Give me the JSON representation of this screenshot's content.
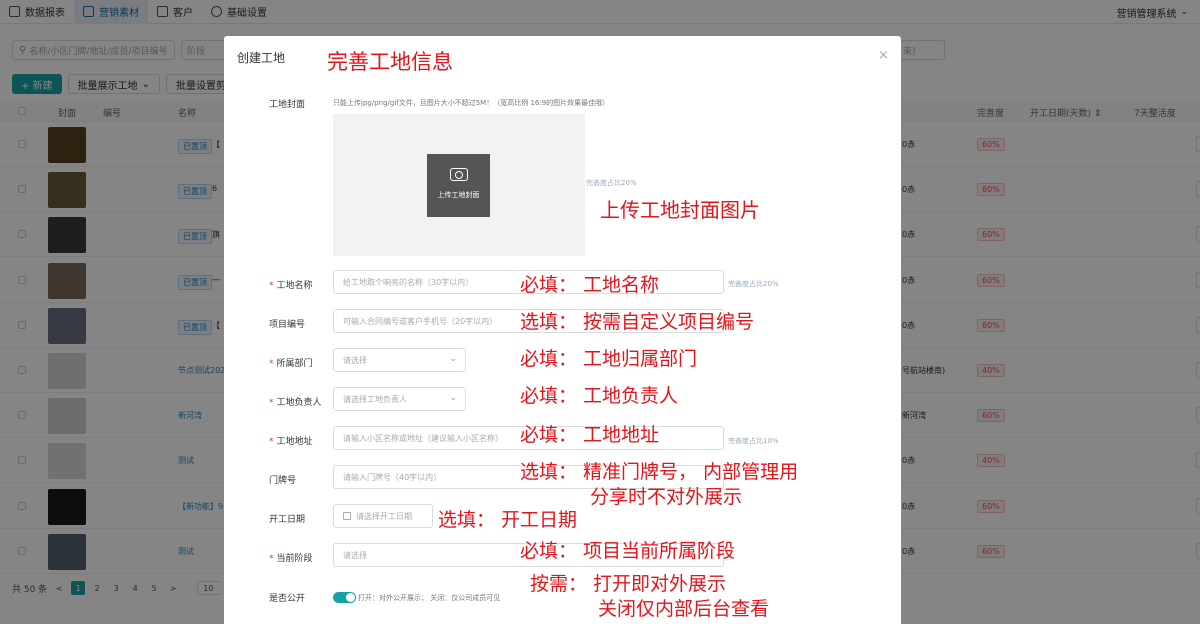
{
  "topnav": {
    "items": [
      {
        "label": "数据报表"
      },
      {
        "label": "营销素材"
      },
      {
        "label": "客户"
      },
      {
        "label": "基础设置"
      }
    ],
    "right_label": "营销管理系统"
  },
  "filters": {
    "search_placeholder": "名称/小区门牌/地址/成员/项目编号",
    "stage_placeholder": "阶段",
    "fragment": "束)"
  },
  "actions": {
    "new_label": "+ 新建",
    "batch_show_label": "批量展示工地",
    "batch_set_label": "批量设置剪辑"
  },
  "table": {
    "headers": {
      "cover": "封面",
      "code": "编号",
      "name": "名称",
      "completeness": "完善度",
      "start_days": "开工日期(天数) ⇕",
      "seven_day": "7天整活度"
    },
    "rows": [
      {
        "tag": "已置顶",
        "tag_tail": "【",
        "name": "",
        "rtext": "0赤",
        "pct": "60%",
        "color": "#5a4020"
      },
      {
        "tag": "已置顶",
        "tag_tail": "6",
        "name": "",
        "rtext": "0赤",
        "pct": "60%",
        "color": "#6a5a3a"
      },
      {
        "tag": "已置顶",
        "tag_tail": "旗",
        "name": "",
        "rtext": "0赤",
        "pct": "60%",
        "color": "#3a3a3a"
      },
      {
        "tag": "已置顶",
        "tag_tail": "一",
        "name": "",
        "rtext": "0赤",
        "pct": "60%",
        "color": "#7a6a5a"
      },
      {
        "tag": "已置顶",
        "tag_tail": "【",
        "name": "",
        "rtext": "0赤",
        "pct": "60%",
        "color": "#6a7080"
      },
      {
        "tag": "",
        "tag_tail": "",
        "name": "节点测试2024",
        "rtext": "号航站楼南)",
        "pct": "40%",
        "color": "#d5d5d5"
      },
      {
        "tag": "",
        "tag_tail": "",
        "name": "新河湾",
        "rtext": "新河湾",
        "pct": "60%",
        "color": "#cfcfcf"
      },
      {
        "tag": "",
        "tag_tail": "",
        "name": "测试",
        "rtext": "0赤",
        "pct": "40%",
        "color": "#d8d8d8"
      },
      {
        "tag": "",
        "tag_tail": "",
        "name": "【新功能】9:",
        "rtext": "0赤",
        "pct": "60%",
        "color": "#1a1a1a"
      },
      {
        "tag": "",
        "tag_tail": "",
        "name": "测试",
        "rtext": "0赤",
        "pct": "60%",
        "color": "#556070"
      }
    ]
  },
  "pager": {
    "total": "共 50 条",
    "prev": "<",
    "pages": [
      "1",
      "2",
      "3",
      "4",
      "5"
    ],
    "next": ">",
    "size": "10"
  },
  "modal": {
    "title": "创建工地",
    "close": "×",
    "cover_label": "工地封面",
    "cover_hint": "只能上传jpg/png/gif文件，且图片大小不超过5M！（宽高比例 16:9的图片效果最佳哦）",
    "upload_label": "上传工地封面",
    "cover_pct": "完善度占比20%",
    "fields": {
      "name": {
        "label": "工地名称",
        "placeholder": "给工地取个响亮的名称（30字以内）",
        "pct": "完善度占比20%"
      },
      "code": {
        "label": "项目编号",
        "placeholder": "可输入合同编号或客户手机号（20字以内）"
      },
      "dept": {
        "label": "所属部门",
        "placeholder": "请选择"
      },
      "owner": {
        "label": "工地负责人",
        "placeholder": "请选择工地负责人"
      },
      "address": {
        "label": "工地地址",
        "placeholder": "请输入小区名称或地址（建议输入小区名称）",
        "pct": "完善度占比10%"
      },
      "door": {
        "label": "门牌号",
        "placeholder": "请输入门牌号（40字以内）"
      },
      "start": {
        "label": "开工日期",
        "placeholder": "请选择开工日期"
      },
      "stage": {
        "label": "当前阶段",
        "placeholder": "请选择"
      },
      "public": {
        "label": "是否公开",
        "text": "打开：对外公开展示；  关闭：仅公司成员可见"
      }
    }
  },
  "annotations": {
    "title": "完善工地信息",
    "cover": "上传工地封面图片",
    "name": "必填：  工地名称",
    "code": "选填：  按需自定义项目编号",
    "dept": "必填：  工地归属部门",
    "owner": "必填：  工地负责人",
    "address": "必填：  工地地址",
    "door1": "选填：  精准门牌号，  内部管理用",
    "door2": "分享时不对外展示",
    "start": "选填：  开工日期",
    "stage": "必填：  项目当前所属阶段",
    "public1": "按需：  打开即对外展示",
    "public2": "关闭仅内部后台查看"
  }
}
